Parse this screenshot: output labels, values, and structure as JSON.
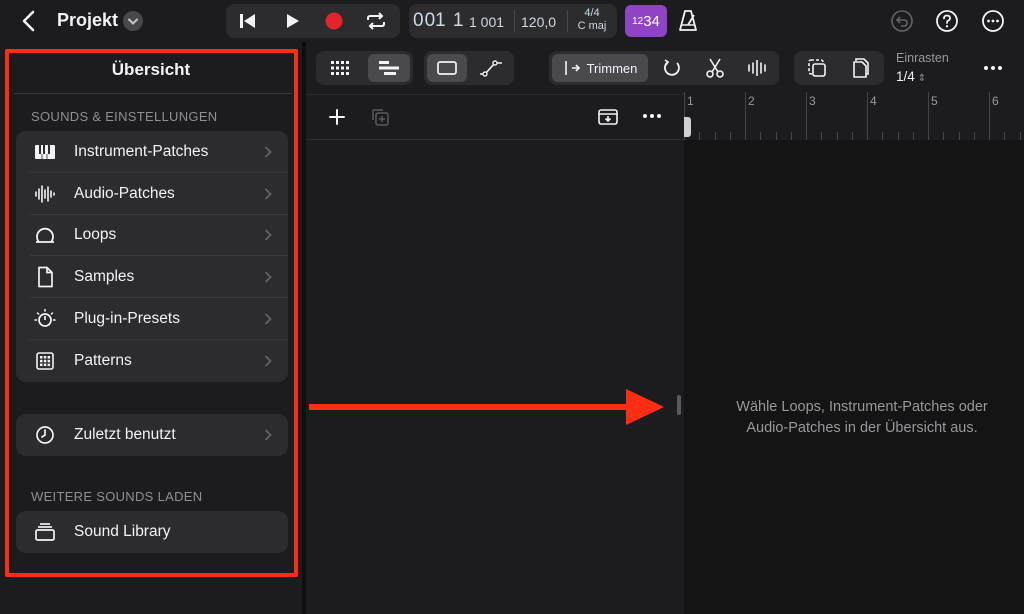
{
  "topbar": {
    "project_title": "Projekt",
    "position_bars": "1 1",
    "position_dim": "00",
    "position_ticks": "1 001",
    "tempo": "120,0",
    "time_signature": "4/4",
    "key": "C maj",
    "count_in_small": "12",
    "count_in_large": "34"
  },
  "toolbar": {
    "trim_label": "Trimmen",
    "snap_label": "Einrasten",
    "snap_value": "1/4"
  },
  "panel": {
    "title": "Übersicht",
    "section1_header": "SOUNDS & EINSTELLUNGEN",
    "items": [
      {
        "label": "Instrument-Patches",
        "icon": "piano-keys-icon"
      },
      {
        "label": "Audio-Patches",
        "icon": "waveform-icon"
      },
      {
        "label": "Loops",
        "icon": "loop-icon"
      },
      {
        "label": "Samples",
        "icon": "document-icon"
      },
      {
        "label": "Plug-in-Presets",
        "icon": "dial-icon"
      },
      {
        "label": "Patterns",
        "icon": "grid-pattern-icon"
      }
    ],
    "recent_label": "Zuletzt benutzt",
    "section2_header": "WEITERE SOUNDS LADEN",
    "library_label": "Sound Library"
  },
  "ruler": {
    "bars": [
      "1",
      "2",
      "3",
      "4",
      "5",
      "6"
    ]
  },
  "hint": {
    "line1": "Wähle Loops, Instrument-Patches oder",
    "line2": "Audio-Patches in der Übersicht aus."
  },
  "colors": {
    "accent_red": "#ff2d14",
    "record_red": "#e0242a",
    "count_in_purple": "#8e44c4",
    "background": "#1c1c1e"
  }
}
